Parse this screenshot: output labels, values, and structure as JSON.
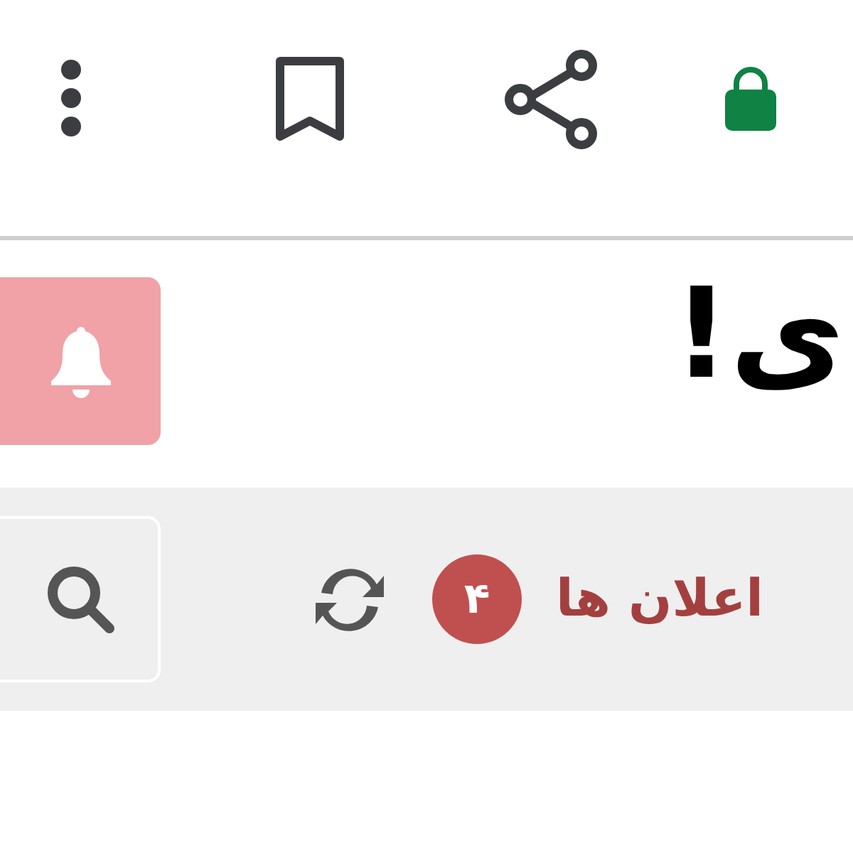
{
  "header": {
    "title": "ی!"
  },
  "notifications_bar": {
    "title": "اعلان ها",
    "count": "۴"
  }
}
